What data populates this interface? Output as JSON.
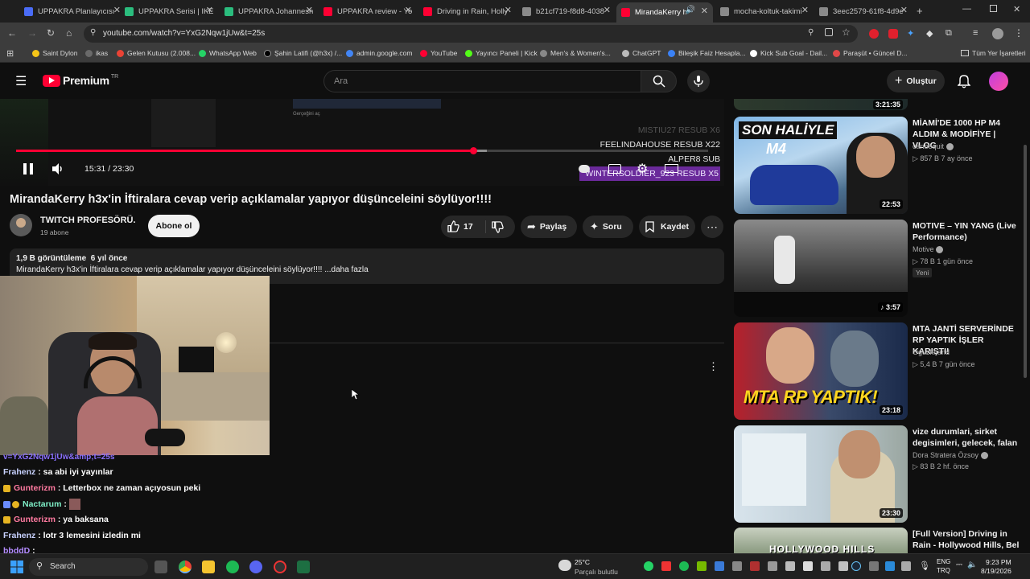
{
  "browser": {
    "tabs": [
      {
        "label": "UPPAKRA Planlayıcısı",
        "fav": "#4a6cf7"
      },
      {
        "label": "UPPAKRA Serisi | IKEA",
        "fav": "#2bbd7e"
      },
      {
        "label": "UPPAKRA Johanneshov",
        "fav": "#2bbd7e"
      },
      {
        "label": "UPPAKRA review - Yo",
        "fav": "#ff0033"
      },
      {
        "label": "Driving in Rain, Holly",
        "fav": "#ff0033"
      },
      {
        "label": "b21cf719-f8d8-4038",
        "fav": "#8a8a8a"
      },
      {
        "label": "MirandaKerry h3x",
        "fav": "#ff0033"
      },
      {
        "label": "mocha-koltuk-takimi",
        "fav": "#8a8a8a"
      },
      {
        "label": "3eec2579-61f8-4d9e",
        "fav": "#8a8a8a"
      }
    ],
    "url": "youtube.com/watch?v=YxG2Nqw1jUw&t=25s",
    "bookmarks": [
      {
        "label": "Saint Dylon",
        "color": "#f5c518"
      },
      {
        "label": "ikas",
        "color": "#6a6a6a"
      },
      {
        "label": "Gelen Kutusu (2.008...",
        "color": "#ea4335"
      },
      {
        "label": "WhatsApp Web",
        "color": "#25d366"
      },
      {
        "label": "Şahin Latifi (@h3x) /...",
        "color": "#000000"
      },
      {
        "label": "admin.google.com",
        "color": "#4285f4"
      },
      {
        "label": "YouTube",
        "color": "#ff0033"
      },
      {
        "label": "Yayıncı Paneli | Kick",
        "color": "#53fc18"
      },
      {
        "label": "Men's & Women's...",
        "color": "#888888"
      },
      {
        "label": "ChatGPT",
        "color": "#bbbbbb"
      },
      {
        "label": "Bileşik Faiz Hesapla...",
        "color": "#3b82f6"
      },
      {
        "label": "Kick Sub Goal - Dail...",
        "color": "#ffffff"
      },
      {
        "label": "Paraşüt • Güncel D...",
        "color": "#e04848"
      }
    ],
    "all_bookmarks": "Tüm Yer İşaretleri"
  },
  "yt": {
    "logo": "Premium",
    "region": "TR",
    "search_placeholder": "Ara",
    "create": "Oluştur"
  },
  "player": {
    "time": "15:31 / 23:30",
    "progress": 0.66,
    "buffered": 0.68,
    "overlay_lines": [
      "MISTIU27  RESUB X6",
      "FEELINDAHOUSE  RESUB X22",
      "ALPER8  SUB",
      "WINTERSOLDIER_923  RESUB X5"
    ],
    "popup_text": "Gerçeğini aç"
  },
  "video": {
    "title": "MirandaKerry h3x'in İftiralara cevap verip açıklamalar yapıyor düşünceleini söylüyor!!!!",
    "channel": "TWITCH PROFESÖRÜ.",
    "subs": "19 abone",
    "subscribe": "Abone ol",
    "likes": "17",
    "share": "Paylaş",
    "ask": "Soru",
    "save": "Kaydet",
    "views_line": "1,9 B görüntüleme  6 yıl önce",
    "desc": "MirandaKerry h3x'in İftiralara cevap verip açıklamalar yapıyor düşünceleini söylüyor!!!! ...daha fazla"
  },
  "sidebar": [
    {
      "title": "",
      "meta": "",
      "duration": "3:21:35"
    },
    {
      "title": "MİAMİ'DE 1000 HP M4 ALDIM & MODİFİYE | VLOG",
      "channel": "canbequit",
      "meta": "857 B  7 ay önce",
      "duration": "22:53",
      "thumb_text": "SON HALİYLE M4"
    },
    {
      "title": "MOTIVE – YIN YANG (Live Performance)",
      "channel": "Motive",
      "meta": "78 B  1 gün önce",
      "badge": "Yeni",
      "duration": "3:57"
    },
    {
      "title": "MTA JANTİ SERVERİNDE RP YAPTIK İŞLER KARIŞTI!",
      "channel": "Oguzkhand",
      "meta": "5,4 B  7 gün önce",
      "duration": "23:18",
      "thumb_text": "MTA RP YAPTIK!"
    },
    {
      "title": "vize durumlari, sirket degisimleri, gelecek, falan",
      "channel": "Dora Stratera Özsoy",
      "meta": "83 B  2 hf. önce",
      "duration": "23:30"
    },
    {
      "title": "[Full Version] Driving in Rain - Hollywood Hills, Bel",
      "channel": "",
      "meta": "",
      "duration": "",
      "thumb_text": "HOLLYWOOD HILLS"
    }
  ],
  "chat": {
    "url_fragment": "v=YxG2Nqw1jUw&amp;t=25s",
    "messages": [
      {
        "user": "Frahenz",
        "text": ": sa abi iyi yayınlar",
        "color": "#c8d2ff"
      },
      {
        "user": "Gunterizm",
        "text": ": Letterbox ne zaman açıyosun peki",
        "color": "#ff7aa0"
      },
      {
        "user": "Nactarum",
        "text": ":",
        "color": "#7ff0c8"
      },
      {
        "user": "Gunterizm",
        "text": ": ya baksana",
        "color": "#ff7aa0"
      },
      {
        "user": "Frahenz",
        "text": ": lotr 3 lemesini izledin mi",
        "color": "#c8d2ff"
      },
      {
        "user": "bbddD",
        "text": ":",
        "color": "#b48cff"
      }
    ]
  },
  "taskbar": {
    "search": "Search",
    "weather_temp": "25°C",
    "weather_desc": "Parçalı bulutlu",
    "lang1": "ENG",
    "lang2": "TRQ",
    "time": "9:23 PM",
    "date": "8/19/2026"
  }
}
